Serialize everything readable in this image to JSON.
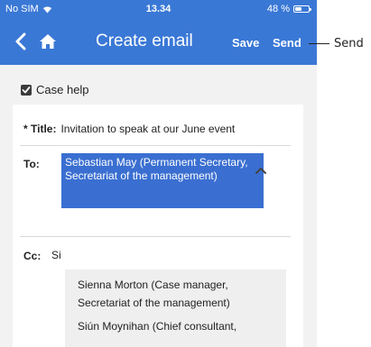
{
  "status_bar": {
    "carrier": "No SIM",
    "time": "13.34",
    "battery": "48 %"
  },
  "nav": {
    "title": "Create email",
    "save_label": "Save",
    "send_label": "Send"
  },
  "case_help": {
    "label": "Case help",
    "checked": true
  },
  "form": {
    "title_label": "* Title:",
    "title_value": "Invitation to speak at our June event",
    "to_label": "To:",
    "to_recipient": "Sebastian May (Permanent Secretary, Secretariat of the management)",
    "cc_label": "Cc:",
    "cc_value": "Si",
    "suggestions": [
      {
        "line1": "Sienna Morton (Case manager,",
        "line2": "Secretariat of the management)"
      },
      {
        "line1": "Siún Moynihan (Chief consultant,"
      }
    ]
  },
  "callout": {
    "label": "Send"
  },
  "colors": {
    "accent": "#3a78d6",
    "chip": "#3a6fd1"
  }
}
